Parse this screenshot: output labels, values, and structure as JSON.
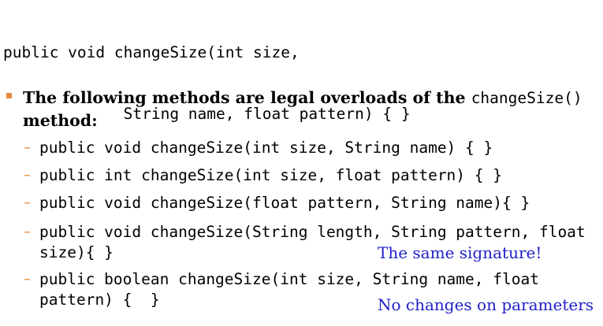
{
  "top_code": {
    "line1": "public void changeSize(int size,",
    "line2": "             String name, float pattern) { }"
  },
  "bullet": {
    "text_before": "The following methods are legal overloads of the ",
    "inline_code": "changeSize()",
    "text_after": " method:"
  },
  "items": [
    {
      "lines": [
        "public void changeSize(int size, String name) { }"
      ]
    },
    {
      "lines": [
        "public int changeSize(int size, float pattern) { }"
      ]
    },
    {
      "lines": [
        "public void changeSize(float pattern, String name){ }"
      ]
    },
    {
      "lines": [
        "public void changeSize(String length, String pattern, float",
        "size){ }"
      ]
    },
    {
      "lines": [
        "public boolean changeSize(int size, String name, float",
        "pattern) {  }"
      ]
    }
  ],
  "notes": {
    "same_signature": "The same signature!",
    "no_changes": "No changes on parameters"
  },
  "colors": {
    "bullet_accent": "#e8883a",
    "note_text": "#2020c8"
  }
}
